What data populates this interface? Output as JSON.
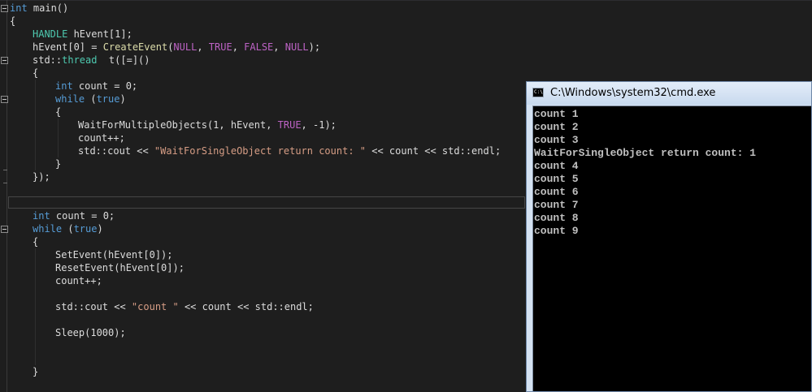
{
  "editor": {
    "lines": {
      "l1_kw": "int",
      "l1_rest": " main()",
      "l2": "{",
      "l3_ty": "HANDLE",
      "l3_rest": " hEvent[1];",
      "l4_a": "hEvent[0] = ",
      "l4_fn": "CreateEvent",
      "l4_b": "(",
      "l4_m1": "NULL",
      "l4_c": ", ",
      "l4_m2": "TRUE",
      "l4_d": ", ",
      "l4_m3": "FALSE",
      "l4_e": ", ",
      "l4_m4": "NULL",
      "l4_f": ");",
      "l5_a": "std::",
      "l5_ty": "thread",
      "l5_b": "  t([=]()",
      "l6": "{",
      "l7_kw": "int",
      "l7_rest": " count = 0;",
      "l8_kw": "while",
      "l8_a": " (",
      "l8_kw2": "true",
      "l8_b": ")",
      "l9": "{",
      "l10_a": "WaitForMultipleObjects(1, hEvent, ",
      "l10_m": "TRUE",
      "l10_b": ", -1);",
      "l11": "count++;",
      "l12_a": "std::cout << ",
      "l12_str": "\"WaitForSingleObject return count: \"",
      "l12_b": " << count << std::endl;",
      "l13": "}",
      "l14": "});",
      "l16_kw": "int",
      "l16_rest": " count = 0;",
      "l17_kw": "while",
      "l17_a": " (",
      "l17_kw2": "true",
      "l17_b": ")",
      "l18": "{",
      "l19": "SetEvent(hEvent[0]);",
      "l20": "ResetEvent(hEvent[0]);",
      "l21": "count++;",
      "l23_a": "std::cout << ",
      "l23_str": "\"count \"",
      "l23_b": " << count << std::endl;",
      "l25": "Sleep(1000);",
      "l28": "}"
    }
  },
  "cmd": {
    "title": "C:\\Windows\\system32\\cmd.exe",
    "icon_text": "C:\\",
    "output": [
      "count 1",
      "count 2",
      "count 3",
      "WaitForSingleObject return count: 1",
      "count 4",
      "count 5",
      "count 6",
      "count 7",
      "count 8",
      "count 9"
    ]
  }
}
